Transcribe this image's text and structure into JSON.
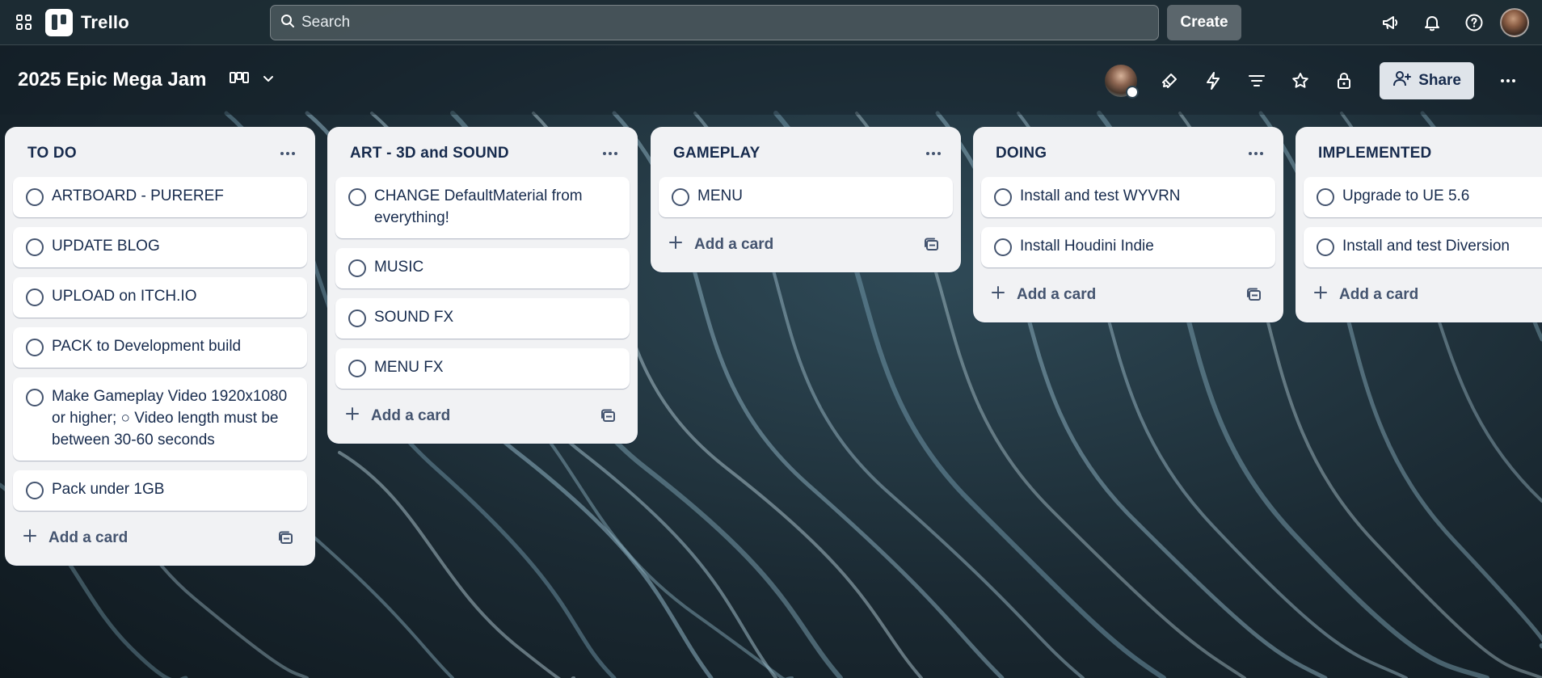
{
  "app": {
    "name": "Trello"
  },
  "search": {
    "placeholder": "Search"
  },
  "topbar": {
    "create_label": "Create",
    "icons": [
      "apps-icon",
      "megaphone-icon",
      "bell-icon",
      "help-icon",
      "avatar"
    ]
  },
  "board": {
    "title": "2025 Epic Mega Jam",
    "share_label": "Share",
    "icons": [
      "board-view-icon",
      "chevron-down-icon",
      "power-ups-icon",
      "automation-icon",
      "filter-icon",
      "star-icon",
      "lock-icon",
      "more-icon"
    ]
  },
  "lists": [
    {
      "title": "TO DO",
      "cards": [
        "ARTBOARD - PUREREF",
        "UPDATE BLOG",
        "UPLOAD on ITCH.IO",
        "PACK to Development build",
        "Make Gameplay Video 1920x1080 or higher; ○ Video length must be between 30-60 seconds",
        "Pack under 1GB"
      ],
      "add_card_label": "Add a card"
    },
    {
      "title": "ART - 3D and SOUND",
      "cards": [
        "CHANGE DefaultMaterial from everything!",
        "MUSIC",
        "SOUND FX",
        "MENU FX"
      ],
      "add_card_label": "Add a card"
    },
    {
      "title": "GAMEPLAY",
      "cards": [
        "MENU"
      ],
      "add_card_label": "Add a card"
    },
    {
      "title": "DOING",
      "cards": [
        "Install and test WYVRN",
        "Install Houdini Indie"
      ],
      "add_card_label": "Add a card"
    },
    {
      "title": "IMPLEMENTED",
      "cards": [
        "Upgrade to UE 5.6",
        "Install and test Diversion"
      ],
      "add_card_label": "Add a card"
    }
  ],
  "colors": {
    "list_bg": "#f1f2f4",
    "card_bg": "#ffffff",
    "text": "#172b4d",
    "header_bg": "#1d2c34"
  }
}
